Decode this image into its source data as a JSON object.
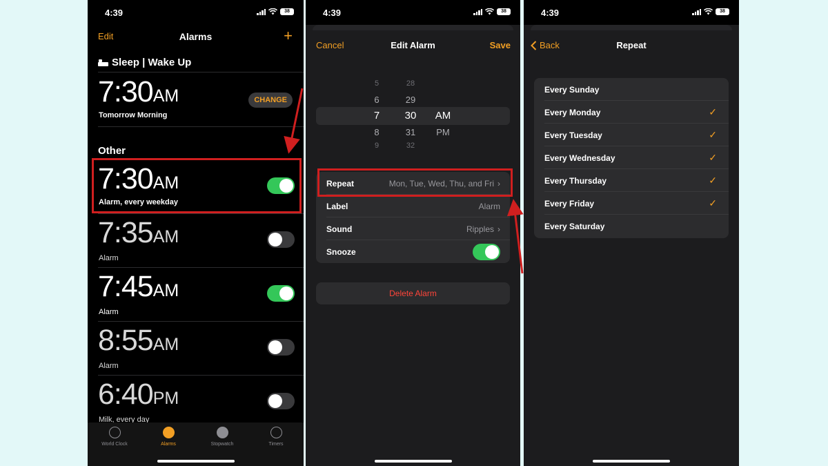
{
  "status": {
    "time": "4:39",
    "battery": "38"
  },
  "screen1": {
    "nav": {
      "edit": "Edit",
      "title": "Alarms",
      "add": "+"
    },
    "sleep_header": "Sleep | Wake Up",
    "sleep_alarm": {
      "time": "7:30",
      "ampm": "AM",
      "label": "Tomorrow Morning",
      "change": "CHANGE"
    },
    "other_header": "Other",
    "alarms": [
      {
        "time": "7:30",
        "ampm": "AM",
        "label": "Alarm, every weekday",
        "on": true
      },
      {
        "time": "7:35",
        "ampm": "AM",
        "label": "Alarm",
        "on": false
      },
      {
        "time": "7:45",
        "ampm": "AM",
        "label": "Alarm",
        "on": true
      },
      {
        "time": "8:55",
        "ampm": "AM",
        "label": "Alarm",
        "on": false
      },
      {
        "time": "6:40",
        "ampm": "PM",
        "label": "Milk, every day",
        "on": false
      }
    ],
    "tabs": [
      {
        "label": "World Clock",
        "icon": "globe-icon",
        "active": false
      },
      {
        "label": "Alarms",
        "icon": "alarm-clock-icon",
        "active": true
      },
      {
        "label": "Stopwatch",
        "icon": "stopwatch-icon",
        "active": false
      },
      {
        "label": "Timers",
        "icon": "timer-icon",
        "active": false
      }
    ]
  },
  "screen2": {
    "nav": {
      "cancel": "Cancel",
      "title": "Edit Alarm",
      "save": "Save"
    },
    "picker": {
      "hours": [
        "5",
        "6",
        "7",
        "8",
        "9"
      ],
      "minutes": [
        "28",
        "29",
        "30",
        "31",
        "32"
      ],
      "ampm": [
        "AM",
        "PM"
      ]
    },
    "rows": {
      "repeat": {
        "label": "Repeat",
        "value": "Mon, Tue, Wed, Thu, and Fri"
      },
      "label": {
        "label": "Label",
        "value": "Alarm"
      },
      "sound": {
        "label": "Sound",
        "value": "Ripples"
      },
      "snooze": {
        "label": "Snooze",
        "on": true
      }
    },
    "delete": "Delete Alarm"
  },
  "screen3": {
    "nav": {
      "back": "Back",
      "title": "Repeat"
    },
    "days": [
      {
        "label": "Every Sunday",
        "checked": false
      },
      {
        "label": "Every Monday",
        "checked": true
      },
      {
        "label": "Every Tuesday",
        "checked": true
      },
      {
        "label": "Every Wednesday",
        "checked": true
      },
      {
        "label": "Every Thursday",
        "checked": true
      },
      {
        "label": "Every Friday",
        "checked": true
      },
      {
        "label": "Every Saturday",
        "checked": false
      }
    ]
  },
  "colors": {
    "accent": "#f29f24",
    "toggle_on": "#34c759",
    "highlight": "#d01f1f",
    "destructive": "#ff453a"
  }
}
